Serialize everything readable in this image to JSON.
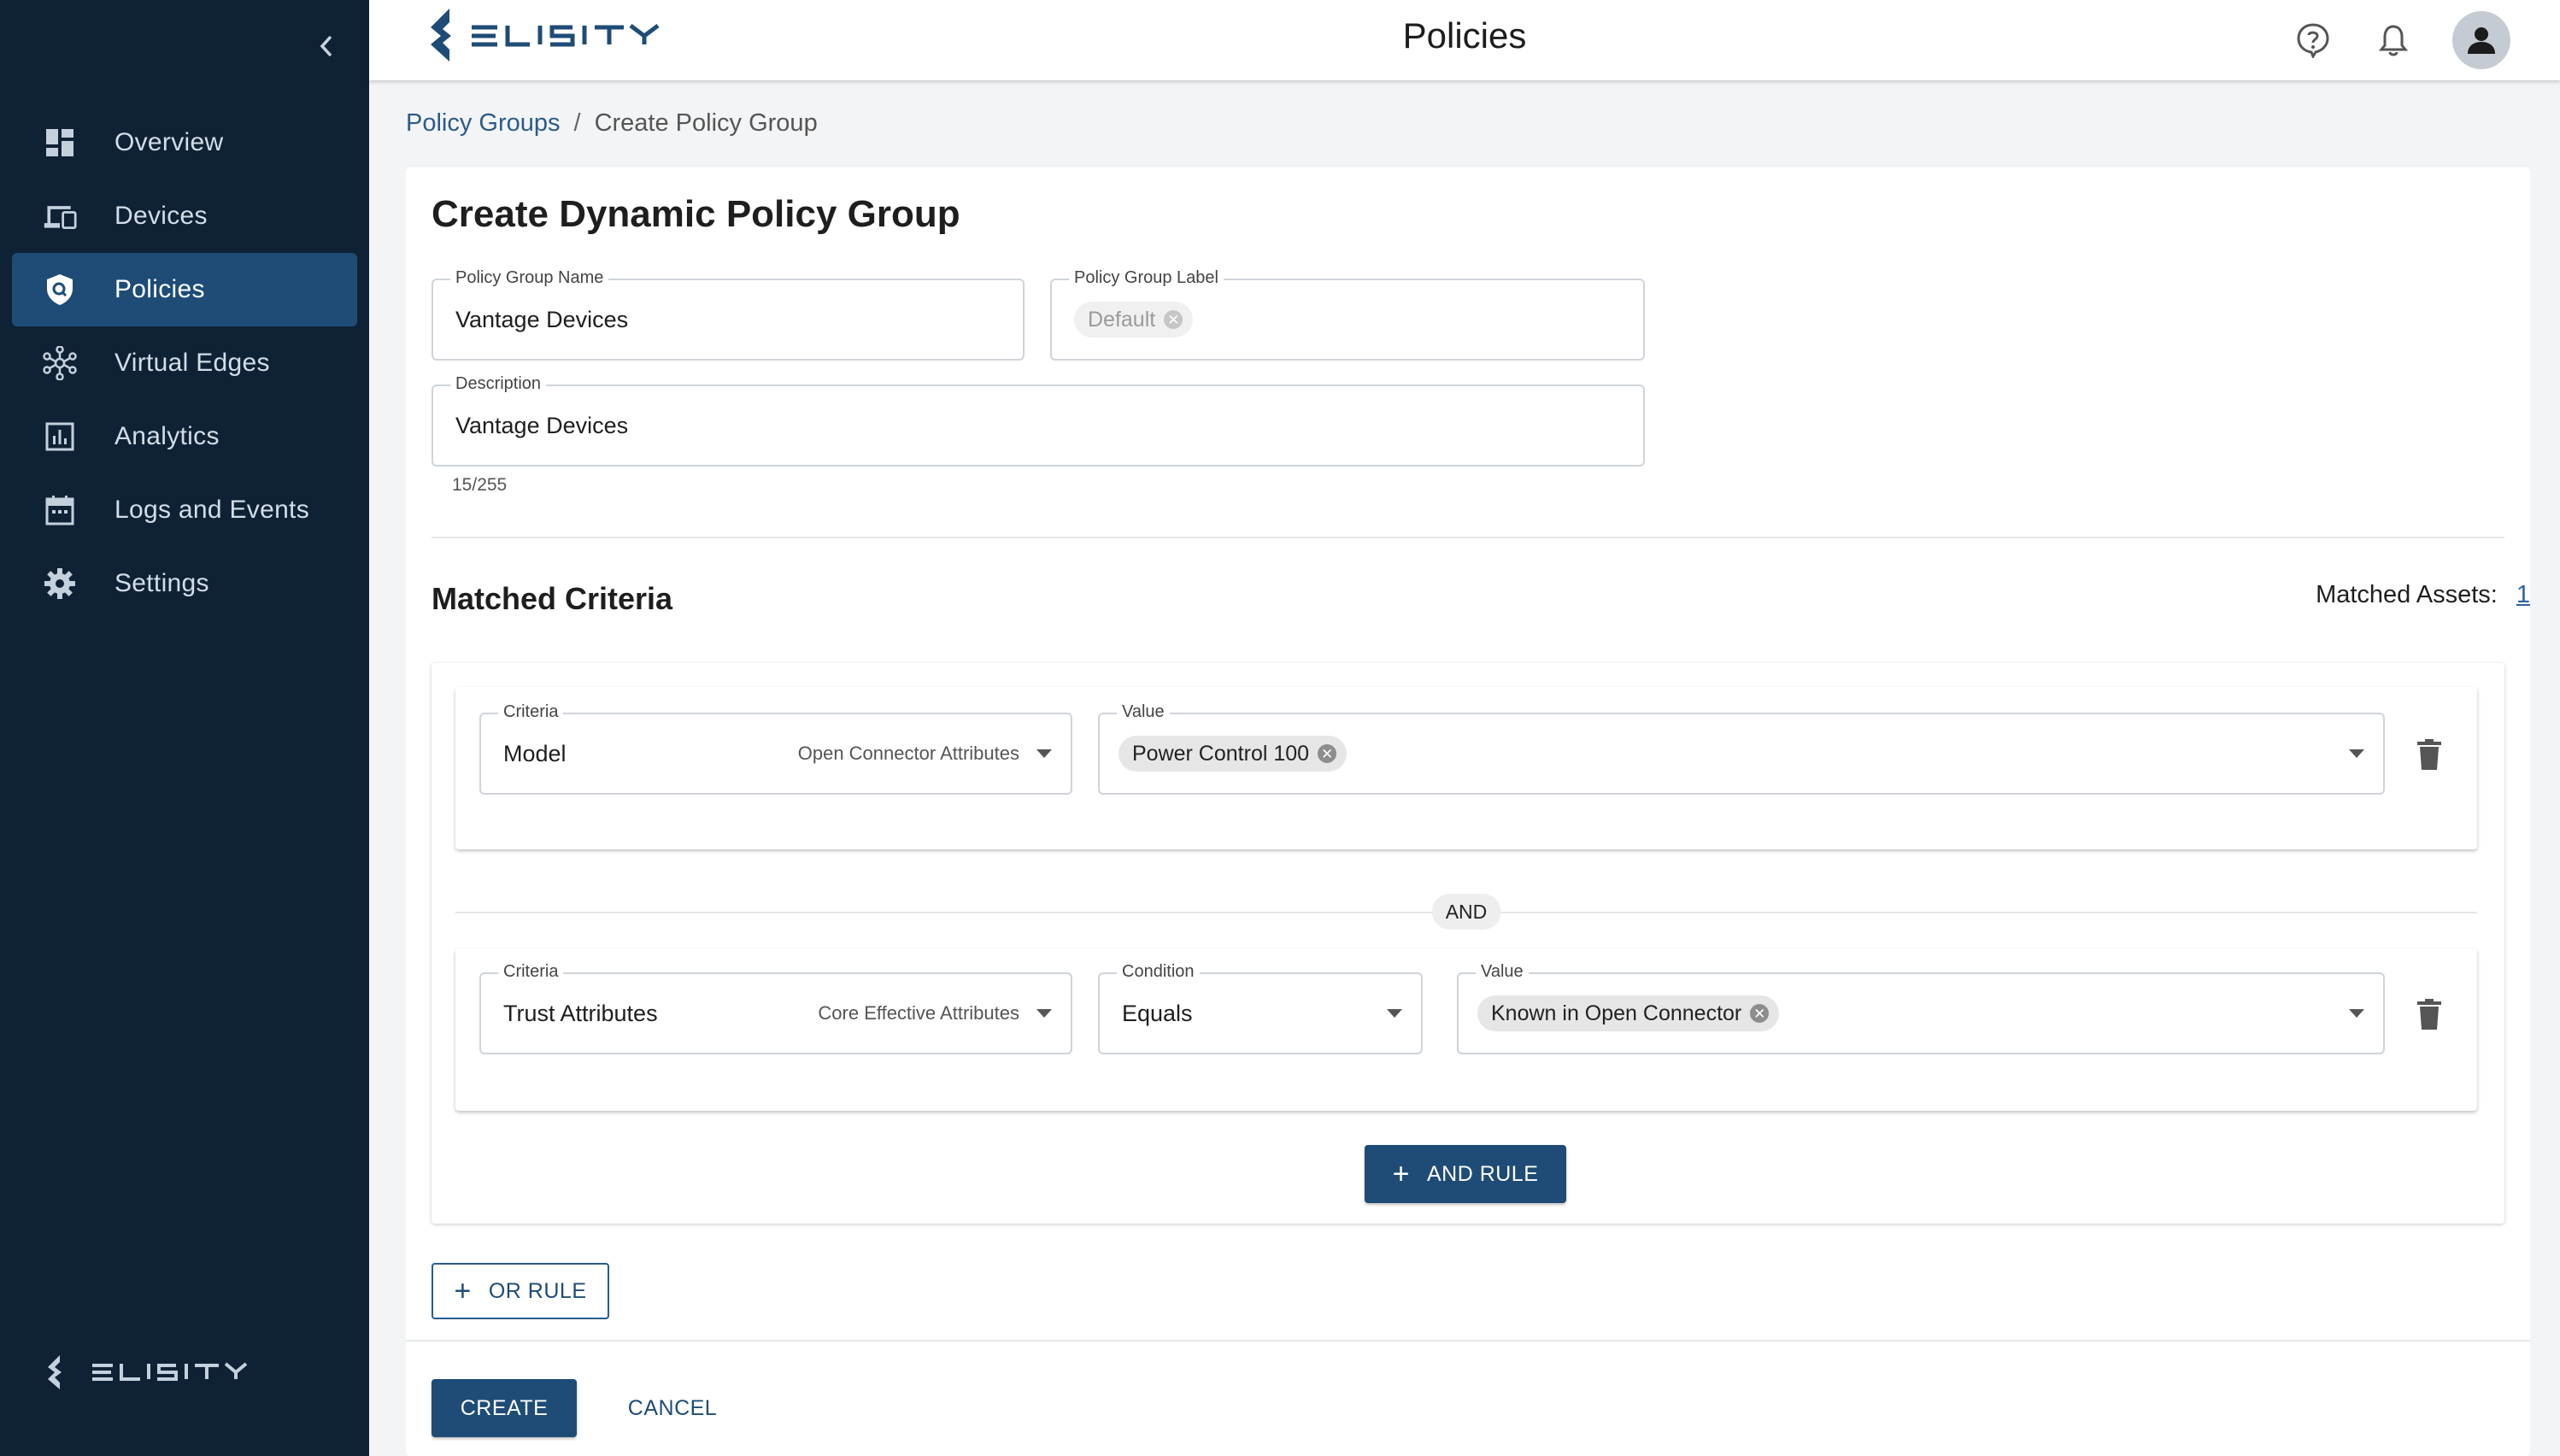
{
  "app": {
    "brand": "ELISITY",
    "page_title": "Policies"
  },
  "sidebar": {
    "collapse_icon": "chevron-left-icon",
    "items": [
      {
        "label": "Overview",
        "icon": "dashboard-icon",
        "active": false
      },
      {
        "label": "Devices",
        "icon": "devices-icon",
        "active": false
      },
      {
        "label": "Policies",
        "icon": "shield-icon",
        "active": true
      },
      {
        "label": "Virtual Edges",
        "icon": "network-hub-icon",
        "active": false
      },
      {
        "label": "Analytics",
        "icon": "bar-chart-icon",
        "active": false
      },
      {
        "label": "Logs and Events",
        "icon": "calendar-icon",
        "active": false
      },
      {
        "label": "Settings",
        "icon": "gear-icon",
        "active": false
      }
    ]
  },
  "header": {
    "icons": [
      "help-icon",
      "bell-icon",
      "user-avatar-icon"
    ]
  },
  "breadcrumb": {
    "parent": "Policy Groups",
    "separator": "/",
    "current": "Create Policy Group"
  },
  "form": {
    "title": "Create Dynamic Policy Group",
    "name": {
      "label": "Policy Group Name",
      "value": "Vantage Devices"
    },
    "group_label": {
      "label": "Policy Group Label",
      "chip": "Default"
    },
    "description": {
      "label": "Description",
      "value": "Vantage Devices",
      "counter": "15/255"
    }
  },
  "criteria": {
    "title": "Matched Criteria",
    "matched_label": "Matched Assets:",
    "matched_count": "1",
    "rule1": {
      "criteria_label": "Criteria",
      "criteria_value": "Model",
      "criteria_group": "Open Connector Attributes",
      "value_label": "Value",
      "value_chip": "Power Control 100"
    },
    "and_label": "AND",
    "rule2": {
      "criteria_label": "Criteria",
      "criteria_value": "Trust Attributes",
      "criteria_group": "Core Effective Attributes",
      "condition_label": "Condition",
      "condition_value": "Equals",
      "value_label": "Value",
      "value_chip": "Known in Open Connector"
    },
    "and_rule_button": "AND RULE"
  },
  "actions": {
    "or_rule": "OR RULE",
    "create": "CREATE",
    "cancel": "CANCEL"
  },
  "colors": {
    "sidebar_bg": "#0f2235",
    "active_item": "#1e4c77",
    "primary": "#1e4c77",
    "link": "#2b5b89"
  }
}
